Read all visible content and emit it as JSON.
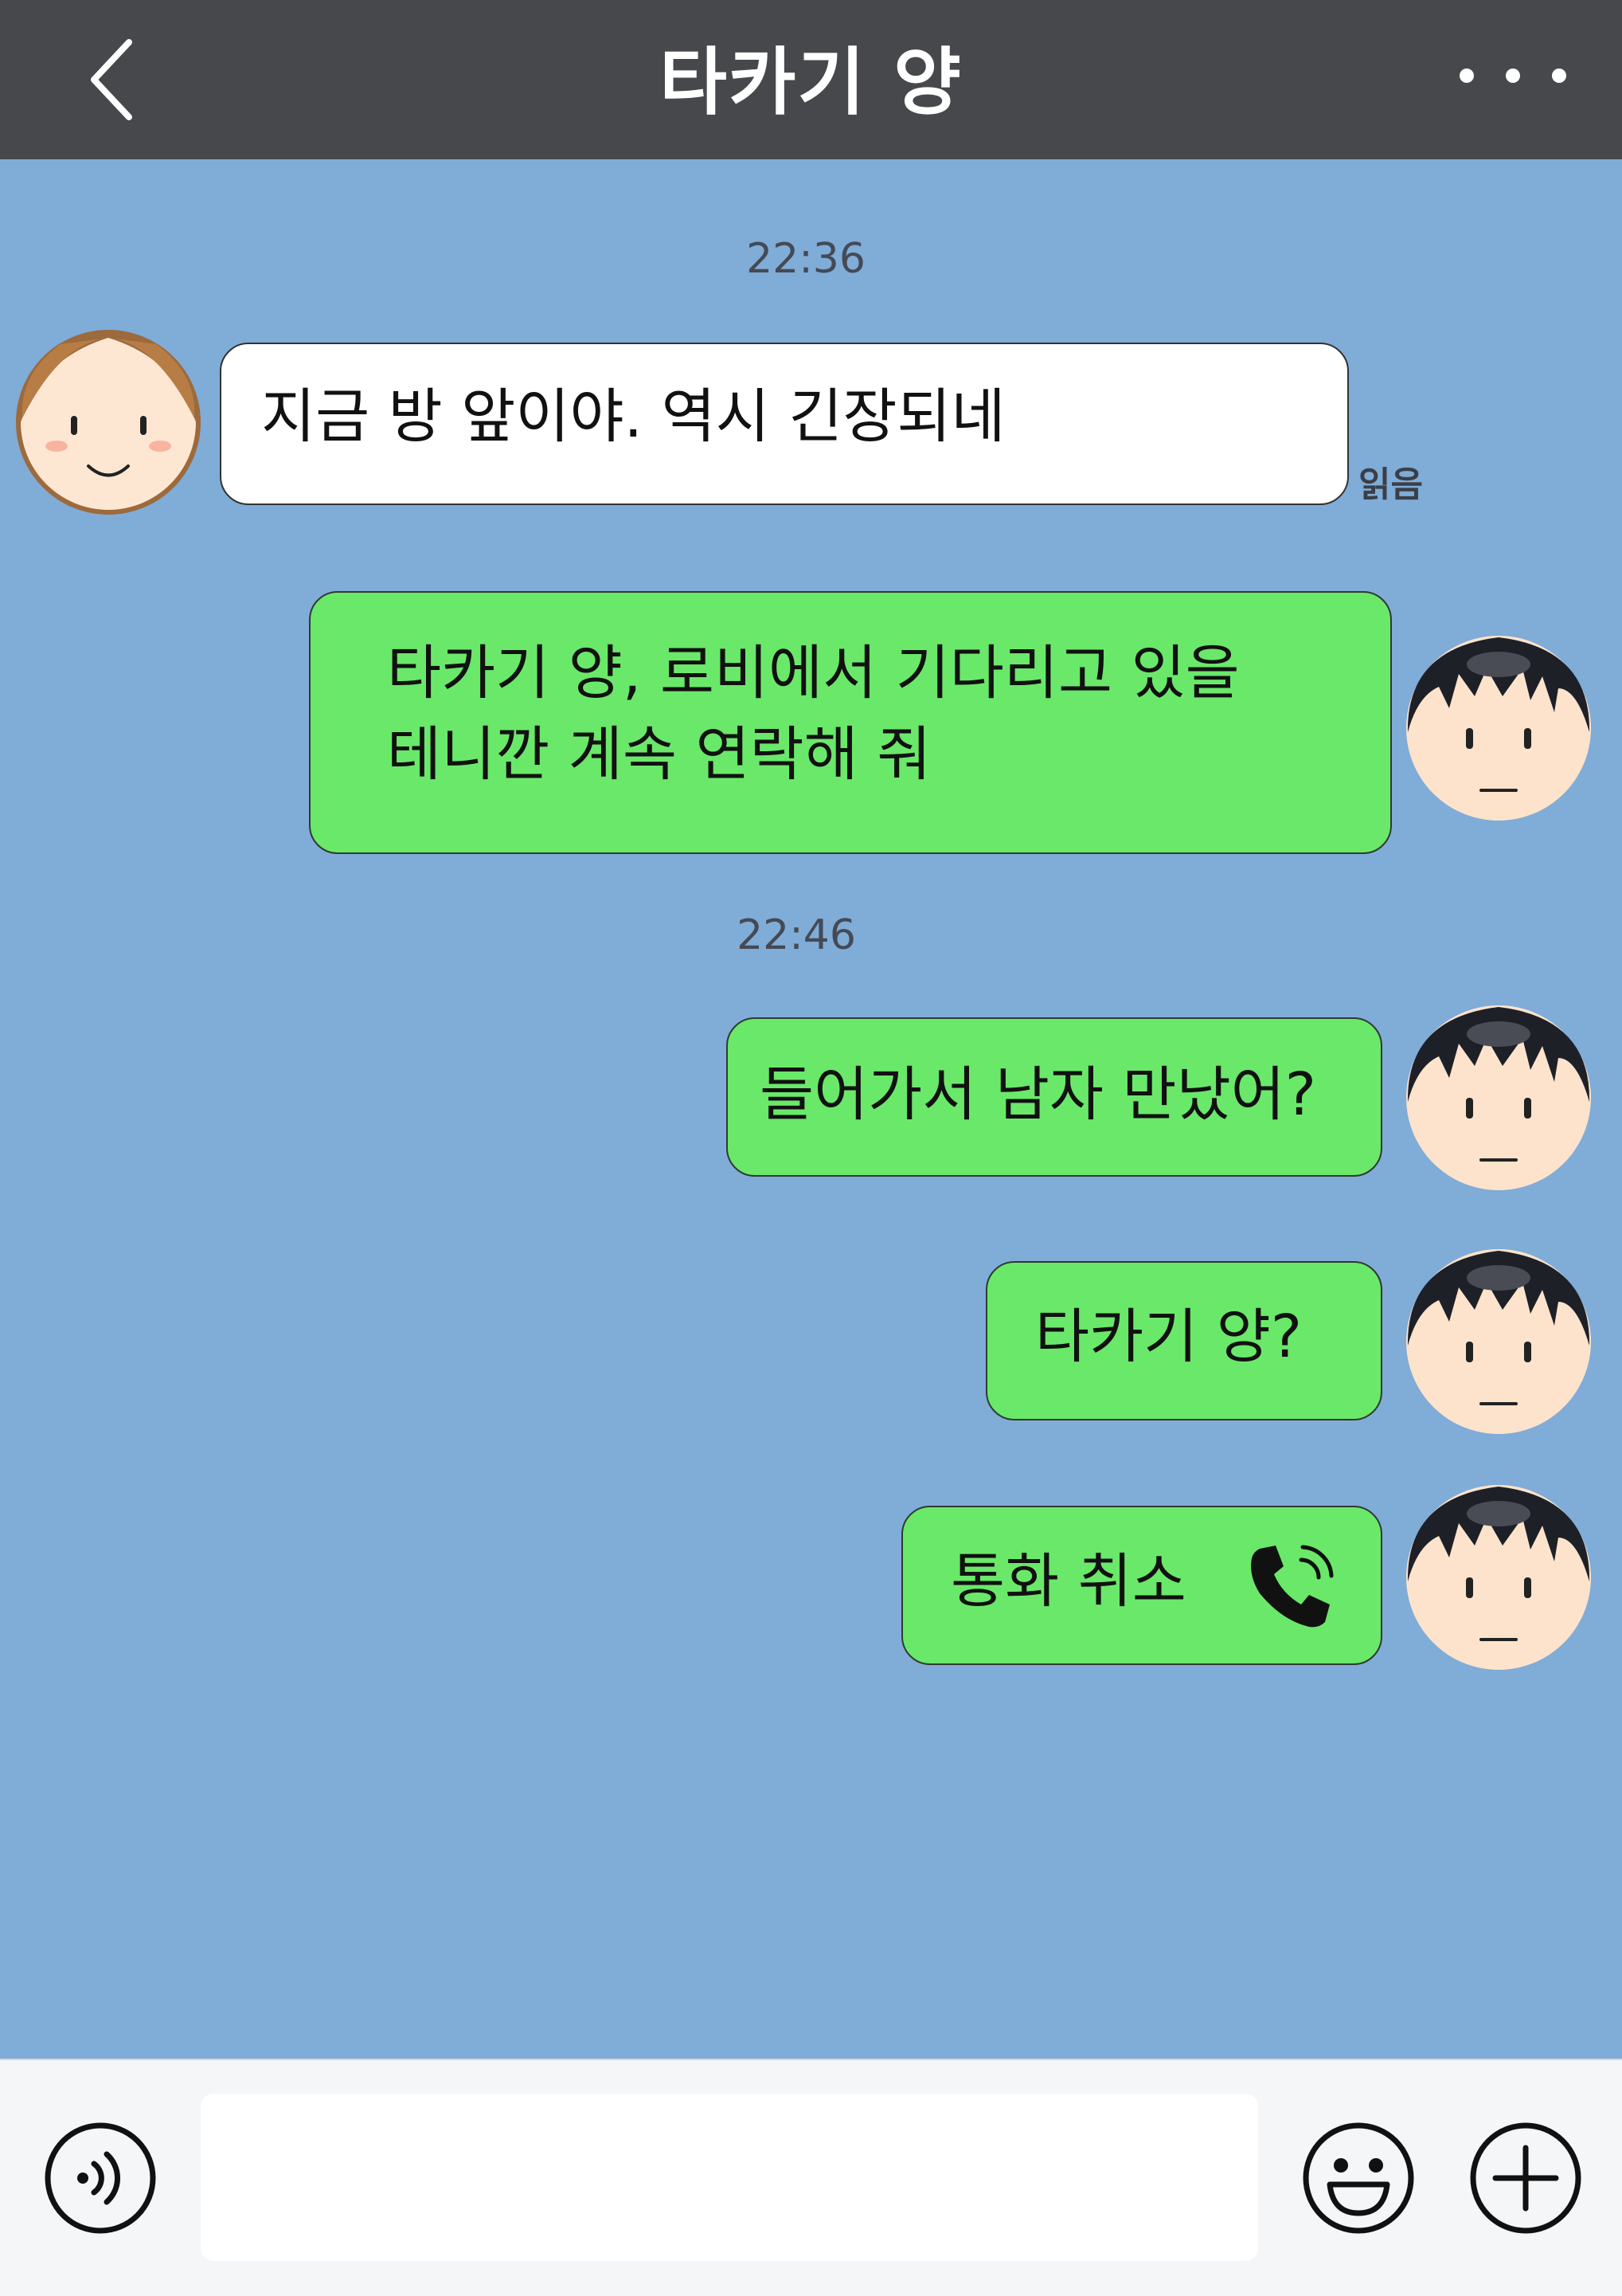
{
  "header": {
    "title": "타카기 양",
    "back_icon": "chevron-left-icon",
    "more_icon": "more-dots-icon"
  },
  "colors": {
    "header_bg": "#46484c",
    "chat_bg": "#80acd8",
    "bubble_in": "#ffffff",
    "bubble_out": "#6ae86a",
    "bottom_bar": "#f5f6f8"
  },
  "messages": [
    {
      "type": "time",
      "text": "22:36"
    },
    {
      "type": "in",
      "text": "지금 방 앞이야. 역시 긴장되네",
      "status": "읽음"
    },
    {
      "type": "out",
      "line1": "타카기 양, 로비에서 기다리고 있을",
      "line2": "테니깐 계속 연락해 줘"
    },
    {
      "type": "time",
      "text": "22:46"
    },
    {
      "type": "out",
      "text": "들어가서 남자 만났어?"
    },
    {
      "type": "out",
      "text": "타카기 양?"
    },
    {
      "type": "out",
      "text": "통화 취소",
      "icon": "phone-call-icon"
    }
  ],
  "composer": {
    "input_value": "",
    "input_placeholder": "",
    "left_icon": "voice-icon",
    "emoji_icon": "smiley-icon",
    "plus_icon": "plus-circle-icon"
  }
}
